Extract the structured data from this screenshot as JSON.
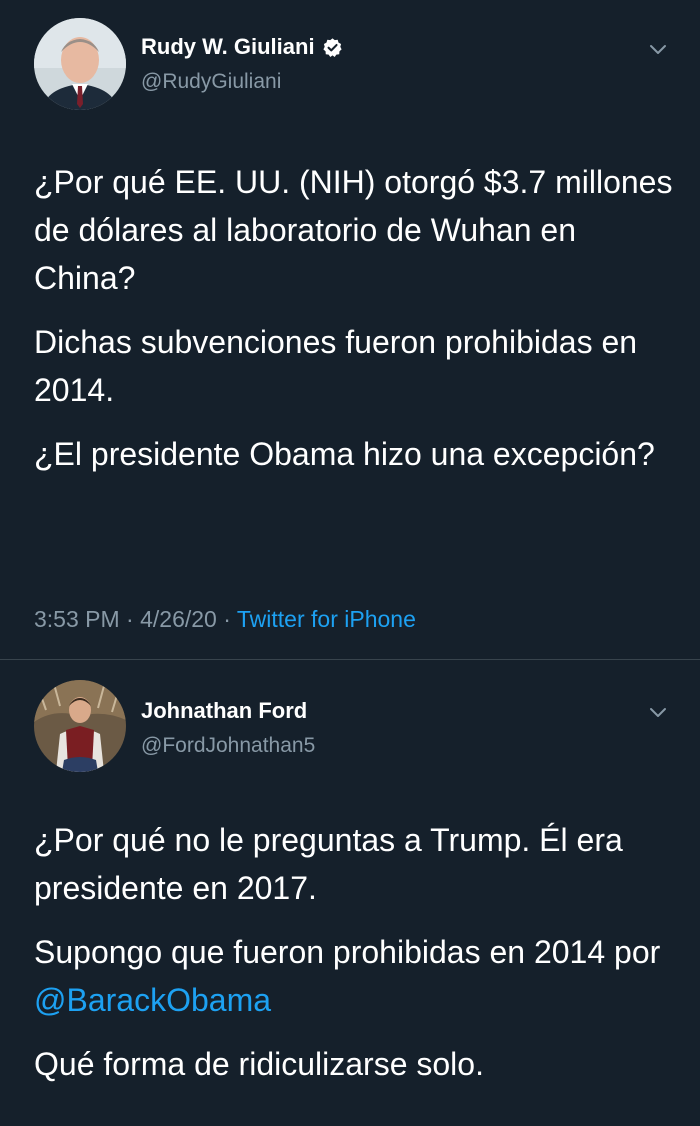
{
  "tweets": [
    {
      "author": {
        "name": "Rudy W. Giuliani",
        "handle": "@RudyGiuliani",
        "verified": true
      },
      "paragraphs": [
        "¿Por qué EE. UU. (NIH) otorgó $3.7 millones de dólares al laboratorio de Wuhan en China?",
        "Dichas subvenciones fueron prohibidas en 2014.",
        "¿El presidente Obama hizo una excepción?"
      ],
      "meta": {
        "time": "3:53 PM",
        "separator": "·",
        "date": "4/26/20",
        "source": "Twitter for iPhone"
      }
    },
    {
      "author": {
        "name": "Johnathan Ford",
        "handle": "@FordJohnathan5",
        "verified": false
      },
      "paragraphs": [
        "¿Por qué no le preguntas a Trump. Él era presidente en 2017.",
        {
          "text_before": "Supongo que fueron prohibidas en 2014 por ",
          "mention": "@BarackObama"
        },
        "Qué forma de ridiculizarse solo."
      ]
    }
  ],
  "colors": {
    "background": "#15202b",
    "text": "#ffffff",
    "secondary_text": "#8899a6",
    "link": "#1da1f2",
    "divider": "#38444d"
  }
}
